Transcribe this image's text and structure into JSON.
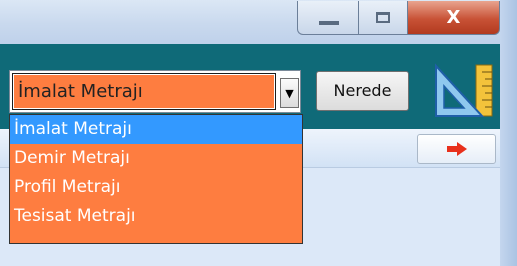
{
  "window": {
    "minimize_glyph": "—",
    "maximize_glyph": "▢",
    "close_glyph": "X"
  },
  "combo": {
    "selected": "İmalat Metrajı",
    "arrow_glyph": "▼",
    "options": [
      "İmalat Metrajı",
      "Demir Metrajı",
      "Profil Metrajı",
      "Tesisat Metrajı"
    ]
  },
  "toolbar": {
    "nerede_label": "Nerede",
    "tool_icon": "set-square-ruler-icon"
  },
  "panel": {
    "next_icon": "red-right-arrow-icon"
  },
  "colors": {
    "accent_orange": "#fe7d40",
    "selection_blue": "#3399ff",
    "toolbar_teal": "#0f6a78",
    "close_red": "#c85236"
  }
}
